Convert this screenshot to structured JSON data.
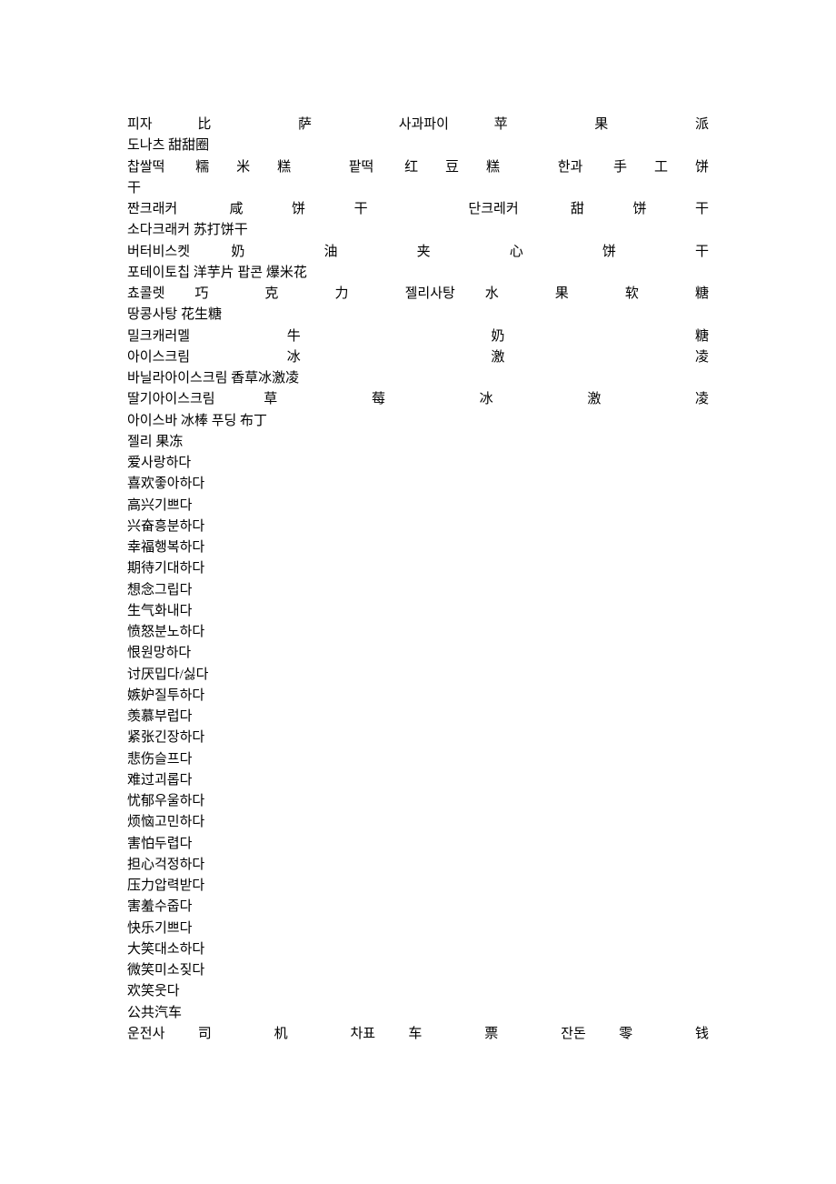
{
  "lines": [
    {
      "text": "&#54588;&#51088;  比 萨  &#49324;&#44284;&#54028;&#51060;  苹 果 派",
      "justify": true
    },
    {
      "text": "&#46020;&#45208;&#52768; 甜甜圈",
      "justify": false
    },
    {
      "text": "&#52281;&#49920;&#46497; 糯米糕 &#54053;&#46497; 红豆糕 &#54620;&#44284; 手工饼",
      "justify": true
    },
    {
      "text": "干",
      "justify": false
    },
    {
      "text": "&#51680;&#53356;&#47000;&#52964; 咸饼干 &#45800;&#53356;&#47112;&#52964; 甜饼干",
      "justify": true
    },
    {
      "text": "&#49548;&#45796;&#53356;&#47000;&#52964; 苏打饼干",
      "justify": false
    },
    {
      "text": "&#48260;&#53552;&#48708;&#49828;&#53011;  奶 油 夹 心 饼 干",
      "justify": true
    },
    {
      "text": "&#54252;&#53580;&#51060;&#53664;&#52841; 洋芋片 &#54045;&#53080; 爆米花",
      "justify": false
    },
    {
      "text": "&#52600;&#53084;&#47131; 巧 克 力  &#51236;&#47532;&#49324;&#53461; 水 果 软 糖",
      "justify": true
    },
    {
      "text": "&#46405;&#53097;&#49324;&#53461; 花生糖",
      "justify": false
    },
    {
      "text": "&#48128;&#53356;&#52880;&#47084;&#47708;    牛   奶   糖",
      "justify": true
    },
    {
      "text": "&#50500;&#51060;&#49828;&#53356;&#47548;      冰    激    凌",
      "justify": true
    },
    {
      "text": "&#48148;&#45776;&#46972;&#50500;&#51060;&#49828;&#53356;&#47548; 香草冰激凌",
      "justify": false
    },
    {
      "text": "&#46392;&#44592;&#50500;&#51060;&#49828;&#53356;&#47548;  草 莓 冰 激 凌",
      "justify": true
    },
    {
      "text": "&#50500;&#51060;&#49828;&#48148; 冰棒 &#54392;&#46377; 布丁",
      "justify": false
    },
    {
      "text": "&#51236;&#47532; 果冻",
      "justify": false
    },
    {
      "text": "爱&#49324;&#46993;&#54616;&#45796;",
      "justify": false
    },
    {
      "text": "喜欢&#51339;&#50500;&#54616;&#45796;",
      "justify": false
    },
    {
      "text": "高兴&#44592;&#49240;&#45796;",
      "justify": false
    },
    {
      "text": "兴奋&#55141;&#48516;&#54616;&#45796;",
      "justify": false
    },
    {
      "text": "幸福&#54665;&#48373;&#54616;&#45796;",
      "justify": false
    },
    {
      "text": "期待&#44592;&#45824;&#54616;&#45796;",
      "justify": false
    },
    {
      "text": "想念&#44536;&#47549;&#45796;",
      "justify": false
    },
    {
      "text": "生气&#54868;&#45236;&#45796;",
      "justify": false
    },
    {
      "text": "愤怒&#48516;&#45432;&#54616;&#45796;",
      "justify": false
    },
    {
      "text": "恨&#50896;&#47581;&#54616;&#45796;",
      "justify": false
    },
    {
      "text": "讨厌&#48137;&#45796;/&#49899;&#45796;",
      "justify": false
    },
    {
      "text": "嫉妒&#51656;&#53804;&#54616;&#45796;",
      "justify": false
    },
    {
      "text": "羡慕&#48512;&#47101;&#45796;",
      "justify": false
    },
    {
      "text": "紧张&#44596;&#51109;&#54616;&#45796;",
      "justify": false
    },
    {
      "text": "悲伤&#49836;&#54532;&#45796;",
      "justify": false
    },
    {
      "text": "难过&#44340;&#47213;&#45796;",
      "justify": false
    },
    {
      "text": "忧郁&#50864;&#50872;&#54616;&#45796;",
      "justify": false
    },
    {
      "text": "烦恼&#44256;&#48124;&#54616;&#45796;",
      "justify": false
    },
    {
      "text": "害怕&#46160;&#47157;&#45796;",
      "justify": false
    },
    {
      "text": "担心&#44145;&#51221;&#54616;&#45796;",
      "justify": false
    },
    {
      "text": "压力&#50517;&#47141;&#48155;&#45796;",
      "justify": false
    },
    {
      "text": "害羞&#49688;&#51469;&#45796;",
      "justify": false
    },
    {
      "text": "快乐&#44592;&#49240;&#45796;",
      "justify": false
    },
    {
      "text": "大笑&#45824;&#49548;&#54616;&#45796;",
      "justify": false
    },
    {
      "text": "微笑&#48120;&#49548;&#51670;&#45796;",
      "justify": false
    },
    {
      "text": "欢笑&#50883;&#45796;",
      "justify": false
    },
    {
      "text": "公共汽车",
      "justify": false
    },
    {
      "text": "&#50868;&#51204;&#49324; 司 机  &#52264;&#54364; 车 票  &#51092;&#46024; 零 钱",
      "justify": true
    }
  ]
}
